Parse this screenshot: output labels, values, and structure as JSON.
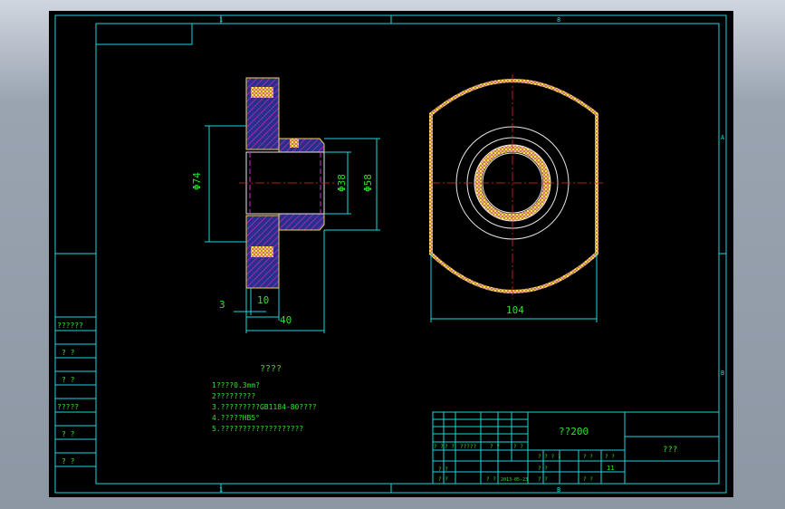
{
  "zone_labels": {
    "top_left": "1",
    "top_mid": "8",
    "right_upper": "A",
    "right_lower": "B",
    "bottom_left": "1",
    "bottom_mid": "B"
  },
  "dimensions": {
    "dia_outer": "Φ74",
    "dia_bore": "Φ38",
    "dia_hub": "Φ58",
    "width_3": "3",
    "width_10": "10",
    "width_40": "40",
    "width_104": "104"
  },
  "notes": {
    "title": "????",
    "items": [
      "1????0.3mm?",
      "2?????????",
      "3.?????????GB1184-80????",
      "4.?????HB5°",
      "5.???????????????????"
    ]
  },
  "left_table": [
    "??????",
    "? ?",
    "? ?",
    "?????",
    "? ?",
    "? ?"
  ],
  "title_block": {
    "part_name": "??200",
    "company": "???",
    "sheet": "11",
    "row_labels": [
      "? ?",
      "? ?",
      "?????",
      "? ?",
      "? ?"
    ],
    "mid_labels": [
      "? ? ? ?",
      "? ?",
      "? ?"
    ],
    "lower_labels": [
      "? ?",
      "? ?",
      "? ?",
      "? ?",
      "? ?",
      "? ?"
    ],
    "date": "2013-05-23"
  },
  "colors": {
    "background": "#000000",
    "frame": "#19d7dc",
    "text": "#2fe02f",
    "center_line": "#e22a2a",
    "hatch": "#f0d24a"
  }
}
